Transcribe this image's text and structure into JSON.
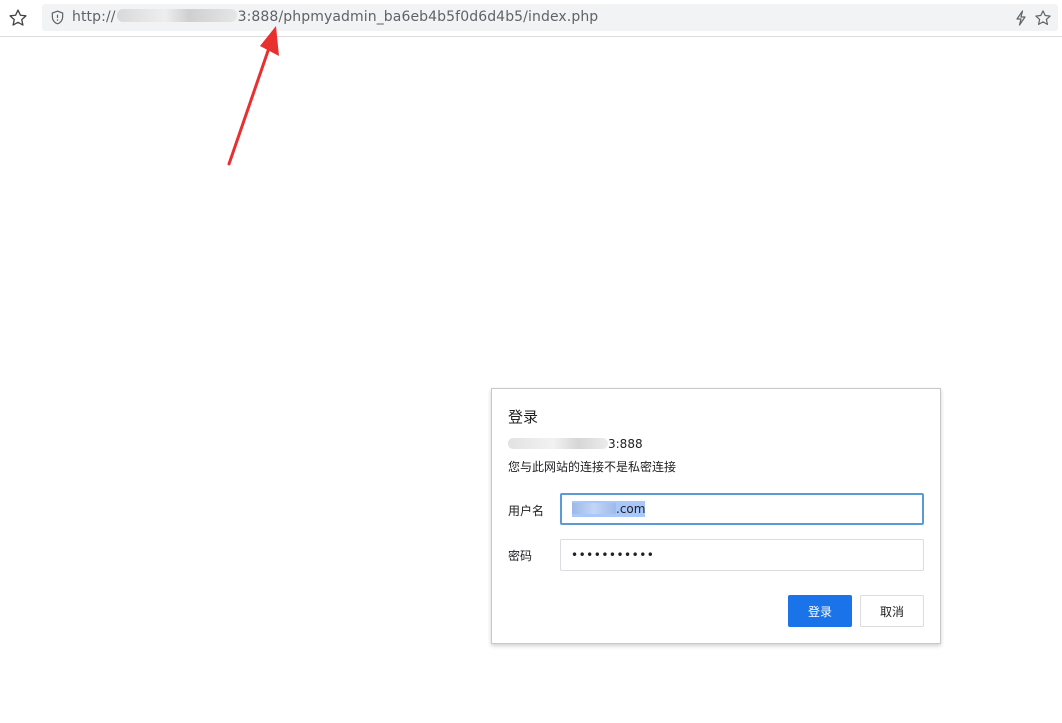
{
  "address_bar": {
    "url_prefix": "http://",
    "url_suffix": "3:888/phpmyadmin_ba6eb4b5f0d6d4b5/index.php"
  },
  "auth_dialog": {
    "title": "登录",
    "origin_suffix": "3:888",
    "warning": "您与此网站的连接不是私密连接",
    "username_label": "用户名",
    "username_value_suffix": ".com",
    "password_label": "密码",
    "password_value": "•••••••••••",
    "login_label": "登录",
    "cancel_label": "取消"
  },
  "colors": {
    "primary_button": "#1a73e8",
    "annotation_arrow": "#e8312f",
    "focus_border": "#5b9bd5",
    "selection": "#a8c7fa"
  },
  "icons": {
    "bookmark": "star-outline-icon",
    "site_info": "shield-icon",
    "action": "lightning-icon",
    "favorite": "star-outline-icon"
  }
}
